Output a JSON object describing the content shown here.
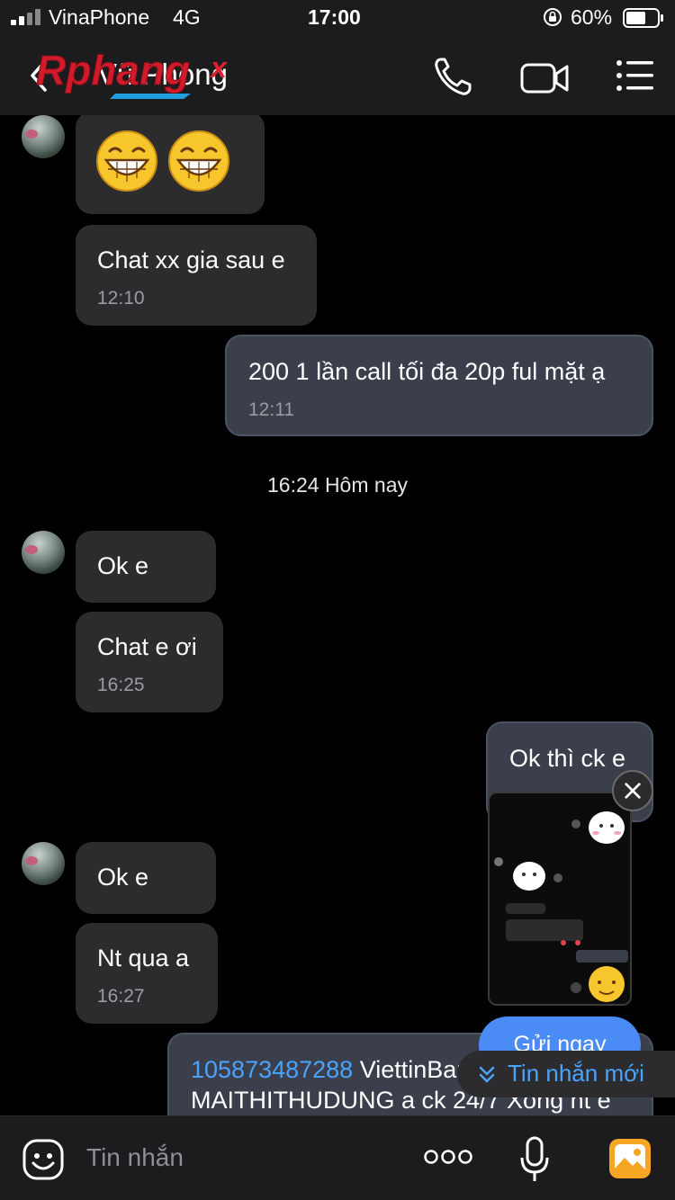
{
  "status_bar": {
    "carrier": "VinaPhone",
    "network": "4G",
    "time": "17:00",
    "battery": "60%",
    "battery_level": 0.6
  },
  "header": {
    "back_icon": "chevron-left-icon",
    "title": "Vũ Phong",
    "watermark": "Rphangx",
    "icons": [
      "phone-icon",
      "video-camera-icon",
      "menu-icon"
    ]
  },
  "messages": [
    {
      "direction": "in",
      "content": "😁😁",
      "time": ""
    },
    {
      "direction": "in",
      "content": "Chat xx gia sau e",
      "time": "12:10"
    },
    {
      "direction": "out",
      "content": "200 1 lần call tối đa 20p ful mặt ạ",
      "time": "12:11"
    },
    {
      "direction": "separator",
      "content": "16:24 Hôm nay"
    },
    {
      "direction": "in",
      "content": "Ok e",
      "time": ""
    },
    {
      "direction": "in",
      "content": "Chat e ơi",
      "time": "16:25"
    },
    {
      "direction": "out",
      "content": "Ok thì ck e",
      "time": ""
    },
    {
      "direction": "in",
      "content": "Ok e",
      "time": ""
    },
    {
      "direction": "in",
      "content": "Nt qua a",
      "time": "16:27"
    },
    {
      "direction": "out",
      "content_link": "105873487288",
      "content_rest": " ViettinBank",
      "content_line2": "MAITHITHUDUNG a ck 24/7 Xong nt e"
    }
  ],
  "overlay": {
    "send_now": "Gửi ngay",
    "new_messages": "Tin nhắn mới",
    "close_icon": "close-icon"
  },
  "input_bar": {
    "placeholder": "Tin nhắn",
    "icons": [
      "sticker-icon",
      "more-icon",
      "microphone-icon",
      "gallery-icon"
    ]
  },
  "colors": {
    "background": "#000000",
    "bar": "#1c1c1e",
    "incoming_bubble": "#2c2c2e",
    "outgoing_bubble": "#3a3f4b",
    "accent": "#4a8bf5",
    "link": "#4aa3ff"
  }
}
